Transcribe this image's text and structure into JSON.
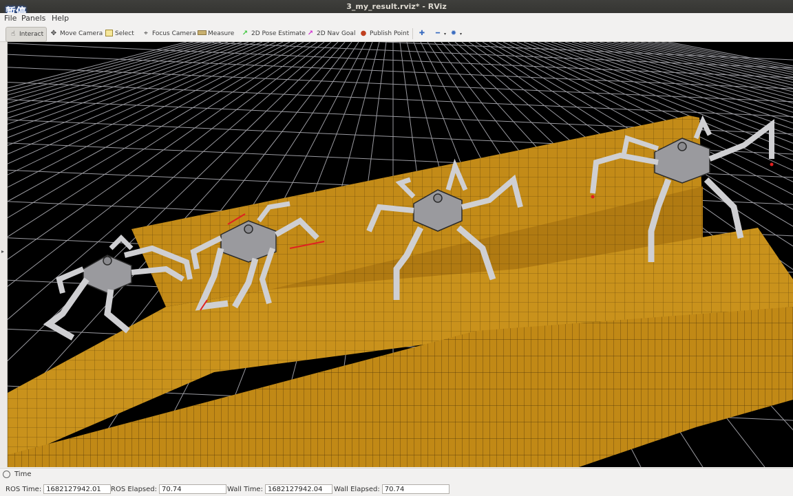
{
  "window": {
    "title": "3_my_result.rviz* - RViz",
    "overlay_text": "暂停"
  },
  "menu": {
    "file": "File",
    "panels": "Panels",
    "help": "Help"
  },
  "toolbar": {
    "interact": "Interact",
    "move_camera": "Move Camera",
    "select": "Select",
    "focus_camera": "Focus Camera",
    "measure": "Measure",
    "pose_estimate": "2D Pose Estimate",
    "nav_goal": "2D Nav Goal",
    "publish_point": "Publish Point"
  },
  "time_panel": {
    "title": "Time",
    "ros_time_label": "ROS Time:",
    "ros_time_value": "1682127942.01",
    "ros_elapsed_label": "ROS Elapsed:",
    "ros_elapsed_value": "70.74",
    "wall_time_label": "Wall Time:",
    "wall_time_value": "1682127942.04",
    "wall_elapsed_label": "Wall Elapsed:",
    "wall_elapsed_value": "70.74"
  },
  "scene": {
    "background_color": "#000000",
    "grid_color": "#a0a0a4",
    "terrain_color": "#c8901a",
    "robot_color": "#a8a8a8",
    "foot_marker_color": "#e02020",
    "robot_count": 4
  }
}
